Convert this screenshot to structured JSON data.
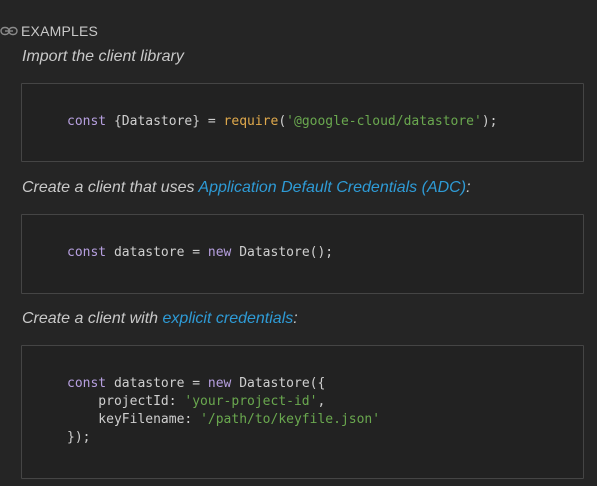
{
  "section": {
    "title": "EXAMPLES",
    "icon": "link-icon"
  },
  "examples": [
    {
      "description": "Import the client library",
      "code": {
        "kw_const": "const",
        "plain_1": " {Datastore} = ",
        "fn_require": "require",
        "plain_2": "(",
        "str_module": "'@google-cloud/datastore'",
        "plain_3": ");"
      }
    },
    {
      "desc_prefix": "Create a client that uses ",
      "desc_link": "Application Default Credentials (ADC)",
      "desc_suffix": ":",
      "code": {
        "kw_const": "const",
        "plain_1": " datastore = ",
        "kw_new": "new",
        "plain_2": " Datastore();"
      }
    },
    {
      "desc_prefix": "Create a client with ",
      "desc_link": "explicit credentials",
      "desc_suffix": ":",
      "code": {
        "kw_const": "const",
        "plain_1": " datastore = ",
        "kw_new": "new",
        "plain_2": " Datastore({",
        "line2_key": "    projectId: ",
        "line2_val": "'your-project-id'",
        "line2_end": ",",
        "line3_key": "    keyFilename: ",
        "line3_val": "'/path/to/keyfile.json'",
        "line4": "});"
      }
    }
  ],
  "colors": {
    "background": "#252525",
    "link": "#2e9bd6",
    "keyword": "#b7a0e0",
    "function": "#e0a94c",
    "string": "#6aa84f"
  }
}
